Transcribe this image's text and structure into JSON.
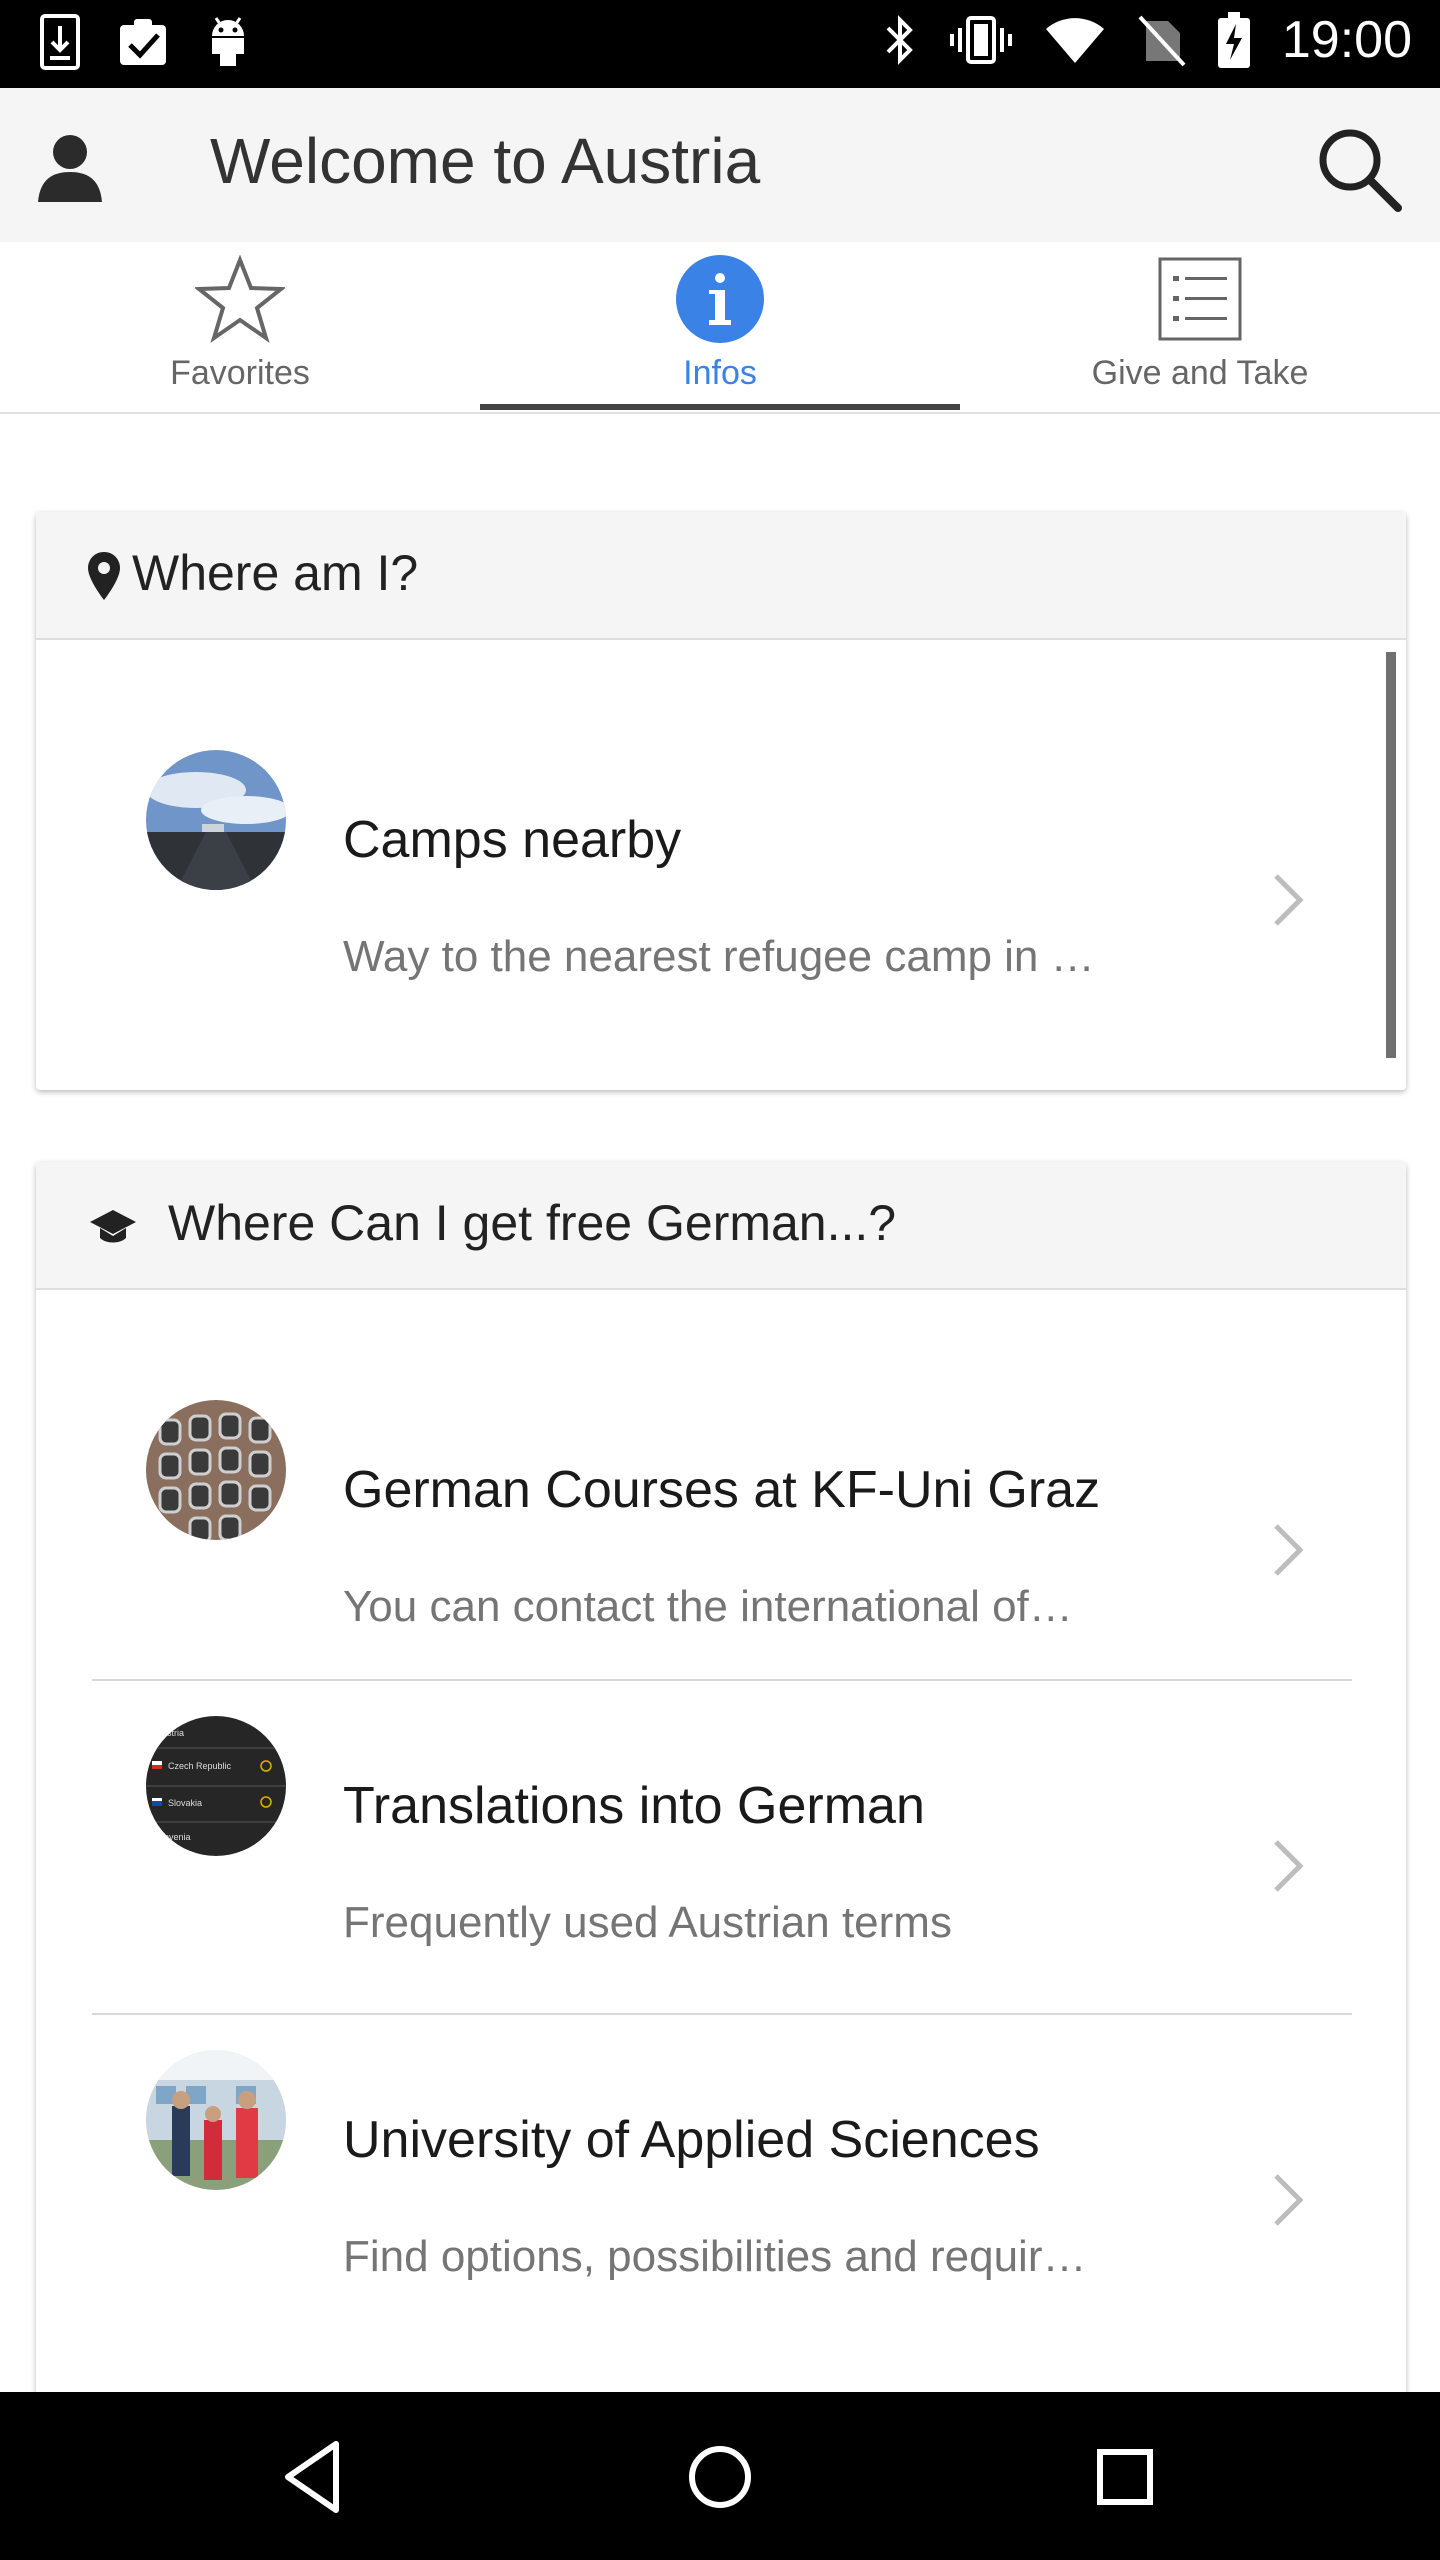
{
  "status_bar": {
    "time": "19:00",
    "left_icons": [
      "download-icon",
      "clipboard-check-icon",
      "android-icon"
    ],
    "right_icons": [
      "bluetooth-icon",
      "vibrate-icon",
      "wifi-icon",
      "no-sim-icon",
      "battery-charging-icon"
    ]
  },
  "app_bar": {
    "title": "Welcome to Austria",
    "left_icon": "user-avatar-icon",
    "right_icon": "search-icon"
  },
  "tabs": [
    {
      "label": "Favorites",
      "icon": "star-icon",
      "active": false
    },
    {
      "label": "Infos",
      "icon": "info-icon",
      "active": true
    },
    {
      "label": "Give and Take",
      "icon": "list-icon",
      "active": false
    }
  ],
  "accent_color": "#3b82e6",
  "sections": [
    {
      "title": "Where am I?",
      "icon": "location-pin-icon",
      "items": [
        {
          "title": "Camps nearby",
          "subtitle": "Way to the nearest refugee camp in …",
          "thumb": "road-sky-photo"
        }
      ]
    },
    {
      "title": "Where Can I get free German...?",
      "icon": "graduation-cap-icon",
      "items": [
        {
          "title": "German Courses at KF-Uni Graz",
          "subtitle": "You can contact the international of…",
          "thumb": "building-windows-photo"
        },
        {
          "title": "Translations into German",
          "subtitle": "Frequently used Austrian terms",
          "thumb": "country-list-photo",
          "thumb_text": [
            "ustria",
            "Czech Republic",
            "Slovakia",
            "lovenia"
          ]
        },
        {
          "title": "University of Applied Sciences",
          "subtitle": "Find options, possibilities and requir…",
          "thumb": "students-photo"
        }
      ]
    }
  ],
  "nav_bar": {
    "buttons": [
      "back-icon",
      "home-icon",
      "recents-icon"
    ]
  }
}
